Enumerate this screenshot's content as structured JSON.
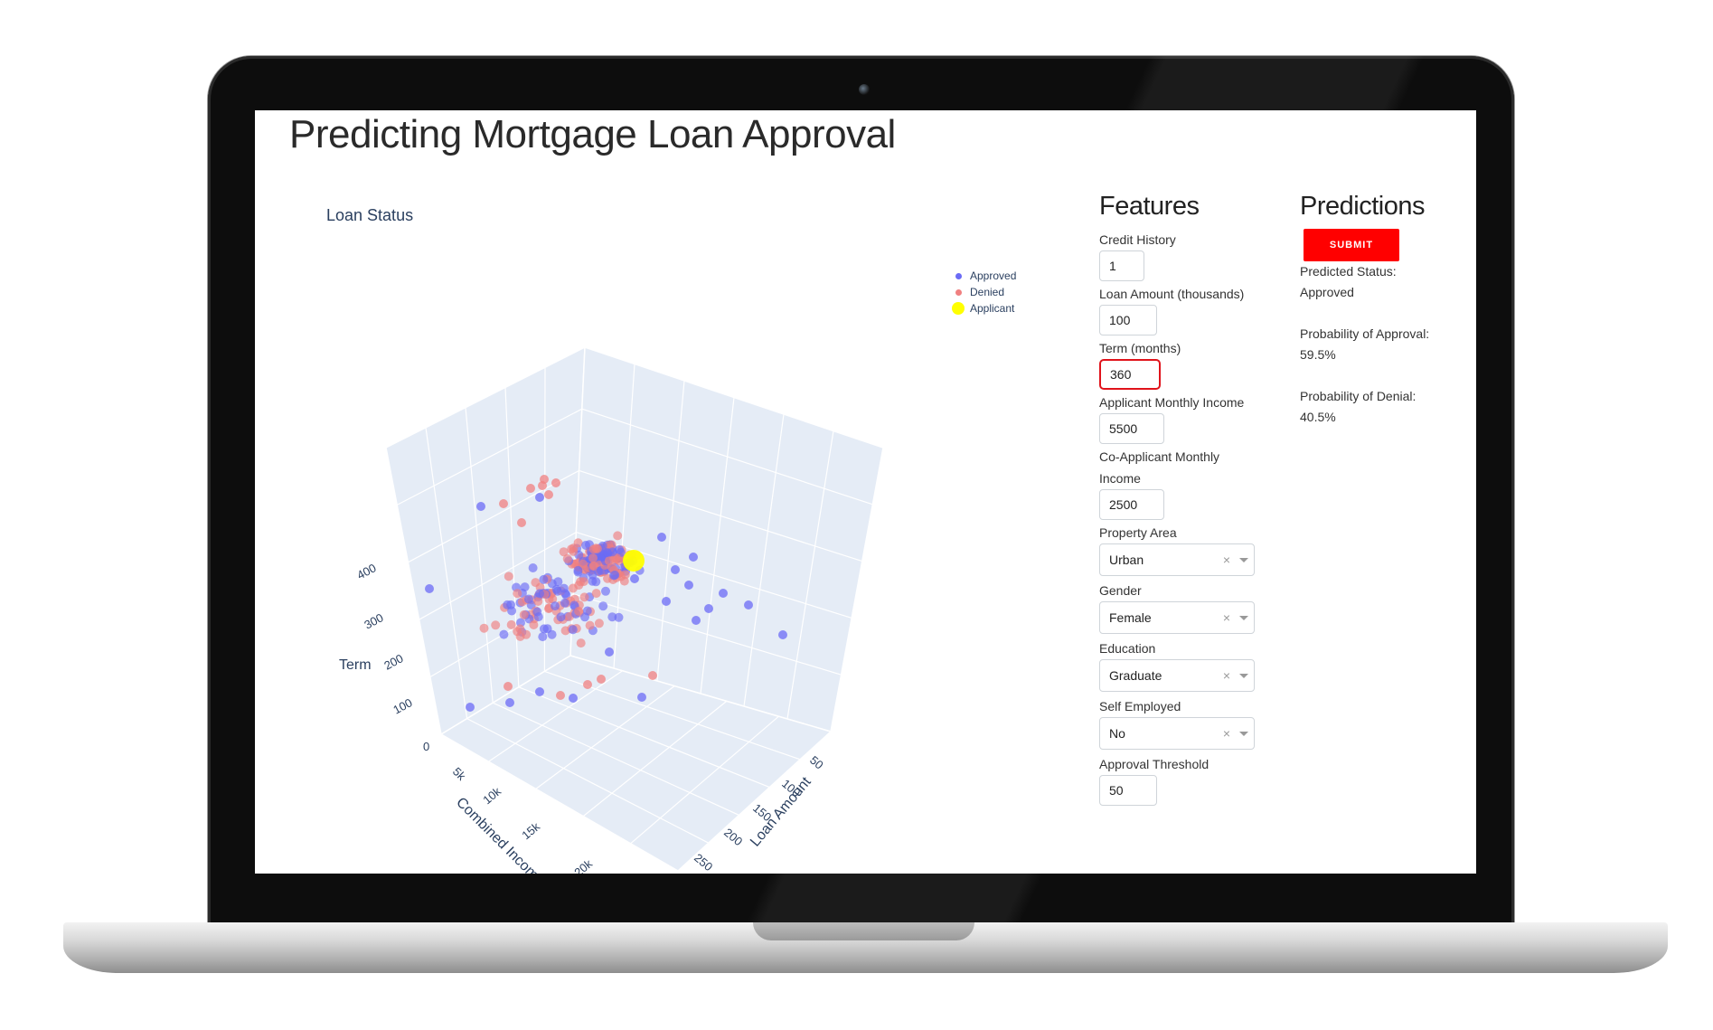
{
  "page": {
    "title": "Predicting Mortgage Loan Approval"
  },
  "plot": {
    "title": "Loan Status",
    "legend": [
      {
        "label": "Approved",
        "color": "#6b6bf5"
      },
      {
        "label": "Denied",
        "color": "#f08080"
      },
      {
        "label": "Applicant",
        "color": "#ffff00"
      }
    ],
    "axis_titles": {
      "z": "Term",
      "x": "Combined Income",
      "y": "Loan Amount"
    },
    "z_ticks": [
      "0",
      "100",
      "200",
      "300",
      "400"
    ],
    "x_ticks": [
      "5k",
      "10k",
      "15k",
      "20k"
    ],
    "y_ticks": [
      "50",
      "100",
      "150",
      "200",
      "250"
    ]
  },
  "chart_data": {
    "type": "scatter",
    "mode": "3d",
    "title": "Loan Status",
    "axes": {
      "x": {
        "label": "Combined Income",
        "ticks": [
          "5k",
          "10k",
          "15k",
          "20k"
        ]
      },
      "y": {
        "label": "Loan Amount",
        "ticks": [
          50,
          100,
          150,
          200,
          250
        ]
      },
      "z": {
        "label": "Term",
        "ticks": [
          0,
          100,
          200,
          300,
          400
        ]
      }
    },
    "legend_position": "top-right",
    "series": [
      {
        "name": "Approved",
        "color": "#6b6bf5",
        "note_points": "dense cluster near Term 360, Loan Amount 100–150, Combined Income 3k–8k"
      },
      {
        "name": "Denied",
        "color": "#f08080"
      },
      {
        "name": "Applicant",
        "color": "#ffff00",
        "points": [
          {
            "income": 8000,
            "loan_amount": 100,
            "term": 360
          }
        ]
      }
    ]
  },
  "features": {
    "title": "Features",
    "credit_history": {
      "label": "Credit History",
      "value": "1"
    },
    "loan_amount": {
      "label": "Loan Amount (thousands)",
      "value": "100"
    },
    "term": {
      "label": "Term (months)",
      "value": "360"
    },
    "applicant_income": {
      "label": "Applicant Monthly Income",
      "value": "5500"
    },
    "coapplicant_income": {
      "label_line1": "Co-Applicant Monthly",
      "label_line2": "Income",
      "value": "2500"
    },
    "property_area": {
      "label": "Property Area",
      "value": "Urban"
    },
    "gender": {
      "label": "Gender",
      "value": "Female"
    },
    "education": {
      "label": "Education",
      "value": "Graduate"
    },
    "self_employed": {
      "label": "Self Employed",
      "value": "No"
    },
    "approval_threshold": {
      "label": "Approval Threshold",
      "value": "50"
    },
    "clear_glyph": "×"
  },
  "predictions": {
    "title": "Predictions",
    "submit_label": "SUBMIT",
    "status_label": "Predicted Status:",
    "status_value": "Approved",
    "approval_label": "Probability of Approval:",
    "approval_value": "59.5%",
    "denial_label": "Probability of Denial:",
    "denial_value": "40.5%"
  }
}
